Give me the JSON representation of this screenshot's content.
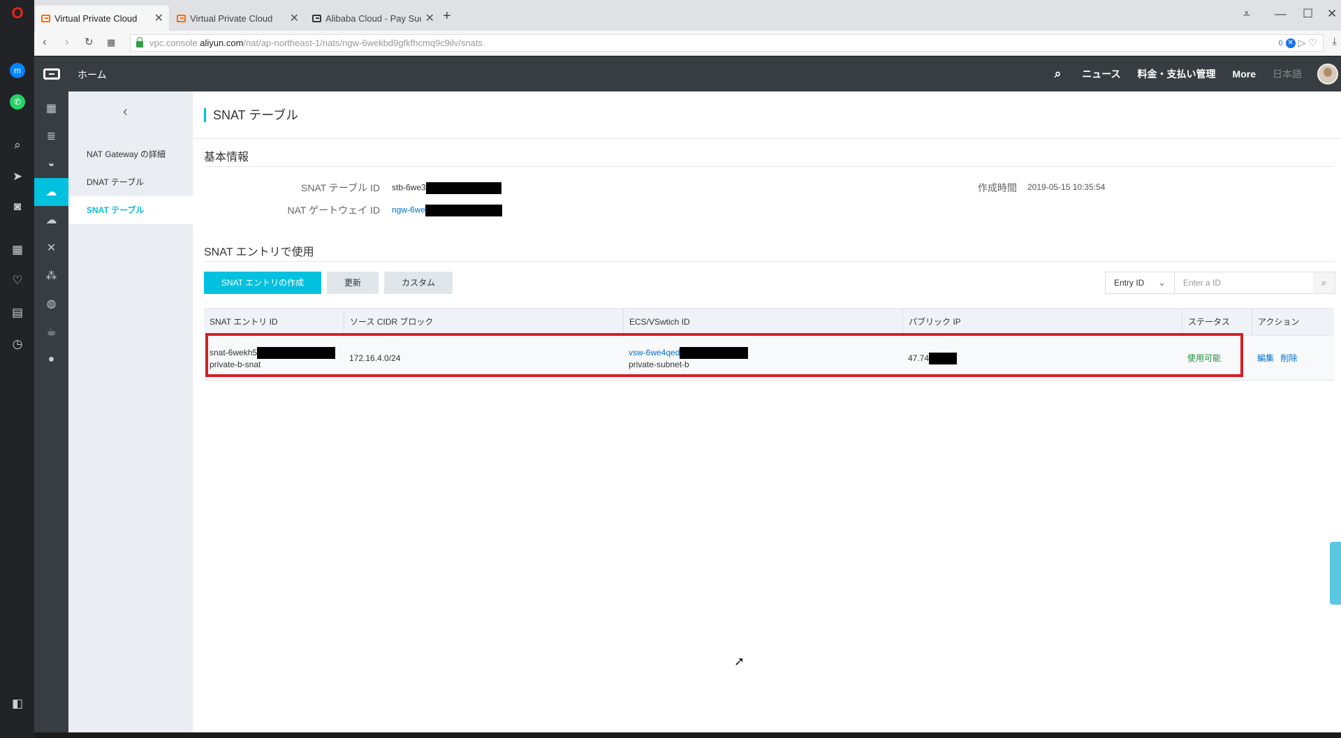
{
  "browser": {
    "tabs": [
      {
        "title": "Virtual Private Cloud",
        "active": true
      },
      {
        "title": "Virtual Private Cloud",
        "active": false
      },
      {
        "title": "Alibaba Cloud - Pay Succe",
        "active": false
      }
    ],
    "url": {
      "prefix": "vpc.console.",
      "domain": "aliyun.com",
      "path": "/nat/ap-northeast-1/nats/ngw-6wekbd9gfkfhcmq9c9ilv/snats"
    },
    "badge_count": "0"
  },
  "topbar": {
    "home_label": "ホーム",
    "news_label": "ニュース",
    "billing_label": "料金・支払い管理",
    "more_label": "More",
    "lang_label": "日本語"
  },
  "subnav": {
    "items": [
      {
        "label": "NAT Gateway の詳細"
      },
      {
        "label": "DNAT テーブル"
      },
      {
        "label": "SNAT テーブル"
      }
    ]
  },
  "page": {
    "title": "SNAT テーブル",
    "basic_info_title": "基本情報",
    "snat_table_id_label": "SNAT テーブル ID",
    "snat_table_id_value": "stb-6we3",
    "nat_gateway_id_label": "NAT ゲートウェイ ID",
    "nat_gateway_id_value": "ngw-6we",
    "created_label": "作成時間",
    "created_value": "2019-05-15 10:35:54",
    "entries_title": "SNAT エントリで使用"
  },
  "toolbar": {
    "create_label": "SNAT エントリの作成",
    "refresh_label": "更新",
    "custom_label": "カスタム",
    "filter_option": "Entry ID",
    "search_placeholder": "Enter a ID"
  },
  "table": {
    "headers": {
      "entry_id": "SNAT エントリ ID",
      "cidr": "ソース CIDR ブロック",
      "vswitch": "ECS/VSwtich ID",
      "public_ip": "パブリック IP",
      "status": "ステータス",
      "action": "アクション"
    },
    "rows": [
      {
        "entry_id": "snat-6wekh5",
        "entry_name": "private-b-snat",
        "cidr": "172.16.4.0/24",
        "vswitch_id": "vsw-6we4qed",
        "vswitch_name": "private-subnet-b",
        "public_ip": "47.74",
        "status": "使用可能",
        "edit_label": "編集",
        "delete_label": "削除"
      }
    ]
  },
  "colors": {
    "accent": "#00c1de",
    "topbar": "#373d41",
    "highlight": "#d51f26",
    "link": "#0070cc",
    "status_ok": "#1e8e3e"
  },
  "icons": {
    "opera_sidebar": [
      "opera-logo-icon",
      "messenger-icon",
      "whatsapp-icon",
      "search-icon",
      "send-icon",
      "camera-icon",
      "apps-icon",
      "heart-icon",
      "news-icon",
      "history-icon",
      "sidebar-toggle-icon"
    ],
    "console_rail": [
      "grid-icon",
      "ecs-icon",
      "database-icon",
      "vpc-icon",
      "cloud-icon",
      "tools-icon",
      "cluster-icon",
      "globe-icon",
      "cup-icon",
      "circle-icon"
    ]
  }
}
